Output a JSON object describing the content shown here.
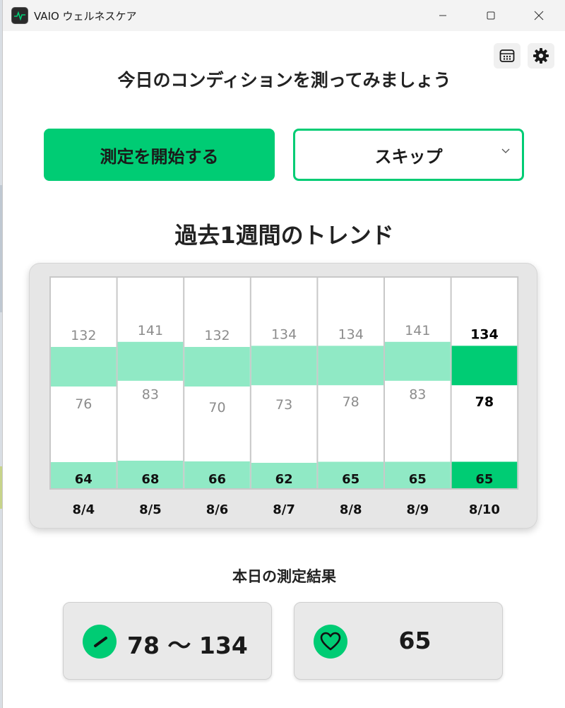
{
  "window": {
    "title": "VAIO ウェルネスケア"
  },
  "main": {
    "heading": "今日のコンディションを測ってみましょう",
    "start_label": "測定を開始する",
    "skip_label": "スキップ"
  },
  "trend": {
    "title": "過去1週間のトレンド"
  },
  "chart_data": {
    "type": "bar",
    "categories": [
      "8/4",
      "8/5",
      "8/6",
      "8/7",
      "8/8",
      "8/9",
      "8/10"
    ],
    "series": [
      {
        "values": [
          132,
          141,
          132,
          134,
          134,
          141,
          134
        ]
      },
      {
        "values": [
          76,
          83,
          70,
          73,
          78,
          83,
          78
        ]
      },
      {
        "values": [
          64,
          68,
          66,
          62,
          65,
          65,
          65
        ]
      }
    ],
    "highlight_index": 6,
    "colors": {
      "band": "#90e9c5",
      "band_today": "#00cc74",
      "label_muted": "#8c8c8c",
      "label_strong": "#000000"
    }
  },
  "today": {
    "title": "本日の測定結果",
    "blood_pressure": "78 〜 134",
    "heart_rate": "65"
  },
  "icons": {
    "calendar": "calendar-icon",
    "settings": "gear-icon",
    "blood_pressure": "gauge-icon",
    "heart_rate": "heart-icon"
  },
  "colors": {
    "accent": "#00cc74"
  }
}
